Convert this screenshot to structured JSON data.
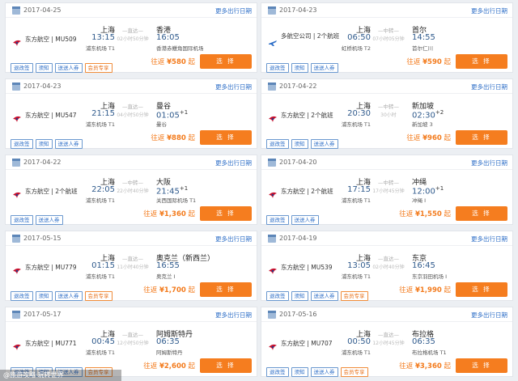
{
  "brand_colors": {
    "accent": "#f57d1f",
    "link": "#2d6ec7",
    "time": "#2f5a8c"
  },
  "more_label": "更多出行日期",
  "select_label": "选 择",
  "dur_label": "—直达—",
  "overlay": "@旅游攻略·玩转世界",
  "cards": [
    {
      "date": "2017-04-25",
      "airline": "东方航空 | MU509",
      "logo": "china-eastern-logo",
      "from": "上海",
      "dep": "13:15",
      "dep_airport": "浦东机场 T1",
      "via": "—直达—",
      "dur": "02小时50分钟",
      "to": "香港",
      "arr": "16:05",
      "arr_airport": "香港赤鱲角国际机场",
      "plus": "",
      "tags": [
        "退改签",
        "须知",
        "送送人券",
        "会员专享"
      ],
      "price_prefix": "往返",
      "price": "¥580",
      "price_suffix": "起"
    },
    {
      "date": "2017-04-23",
      "airline": "多航空公司 | 2个航班",
      "logo": "multi-airline-logo",
      "from": "上海",
      "dep": "06:50",
      "dep_airport": "虹桥机场 T2",
      "via": "—中转—",
      "dur": "07小时05分钟",
      "to": "首尔",
      "arr": "14:55",
      "arr_airport": "首尔仁川",
      "plus": "",
      "tags": [
        "退改签",
        "须知",
        "送送人券"
      ],
      "price_prefix": "往返",
      "price": "¥590",
      "price_suffix": "起"
    },
    {
      "date": "2017-04-23",
      "airline": "东方航空 | MU547",
      "logo": "china-eastern-logo",
      "from": "上海",
      "dep": "21:15",
      "dep_airport": "浦东机场 T1",
      "via": "—直达—",
      "dur": "04小时50分钟",
      "to": "曼谷",
      "arr": "01:05",
      "arr_airport": "曼谷",
      "plus": "+1",
      "tags": [
        "退改签",
        "须知",
        "送送人券"
      ],
      "price_prefix": "往返",
      "price": "¥880",
      "price_suffix": "起"
    },
    {
      "date": "2017-04-22",
      "airline": "东方航空 | 2个航班",
      "logo": "china-eastern-logo",
      "from": "上海",
      "dep": "20:30",
      "dep_airport": "浦东机场 T1",
      "via": "—中转—",
      "dur": "30小时",
      "to": "新加坡",
      "arr": "02:30",
      "arr_airport": "新加坡 3",
      "plus": "+2",
      "tags": [
        "退改签",
        "须知",
        "送送人券"
      ],
      "price_prefix": "往返",
      "price": "¥960",
      "price_suffix": "起"
    },
    {
      "date": "2017-04-22",
      "airline": "东方航空 | 2个航班",
      "logo": "china-eastern-logo",
      "from": "上海",
      "dep": "22:05",
      "dep_airport": "浦东机场 T1",
      "via": "—中转—",
      "dur": "22小时40分钟",
      "to": "大阪",
      "arr": "21:45",
      "arr_airport": "关西国际机场 T1",
      "plus": "+1",
      "tags": [
        "退改签",
        "送送人券"
      ],
      "price_prefix": "往返",
      "price": "¥1,360",
      "price_suffix": "起"
    },
    {
      "date": "2017-04-20",
      "airline": "东方航空 | 2个航班",
      "logo": "china-eastern-logo",
      "from": "上海",
      "dep": "17:15",
      "dep_airport": "浦东机场 T1",
      "via": "—中转—",
      "dur": "17小时45分钟",
      "to": "冲绳",
      "arr": "12:00",
      "arr_airport": "冲绳 I",
      "plus": "+1",
      "tags": [
        "退改签",
        "送送人券"
      ],
      "price_prefix": "往返",
      "price": "¥1,550",
      "price_suffix": "起"
    },
    {
      "date": "2017-05-15",
      "airline": "东方航空 | MU779",
      "logo": "china-eastern-logo",
      "from": "上海",
      "dep": "01:15",
      "dep_airport": "浦东机场 T1",
      "via": "—直达—",
      "dur": "11小时40分钟",
      "to": "奥克兰（新西兰）",
      "arr": "16:55",
      "arr_airport": "奥克兰 I",
      "plus": "",
      "tags": [
        "退改签",
        "须知",
        "送送人券",
        "会员专享"
      ],
      "price_prefix": "往返",
      "price": "¥1,700",
      "price_suffix": "起"
    },
    {
      "date": "2017-04-19",
      "airline": "东方航空 | MU539",
      "logo": "china-eastern-logo",
      "from": "上海",
      "dep": "13:05",
      "dep_airport": "浦东机场 T1",
      "via": "—直达—",
      "dur": "02小时40分钟",
      "to": "东京",
      "arr": "16:45",
      "arr_airport": "东京羽田机场 I",
      "plus": "",
      "tags": [
        "退改签",
        "须知",
        "送送人券",
        "会员专享"
      ],
      "price_prefix": "往返",
      "price": "¥1,990",
      "price_suffix": "起"
    },
    {
      "date": "2017-05-17",
      "airline": "东方航空 | MU771",
      "logo": "china-eastern-logo",
      "from": "上海",
      "dep": "00:45",
      "dep_airport": "浦东机场 T1",
      "via": "—直达—",
      "dur": "12小时50分钟",
      "to": "阿姆斯特丹",
      "arr": "06:35",
      "arr_airport": "阿姆斯特丹",
      "plus": "",
      "tags": [
        "退改签",
        "须知",
        "送送人券",
        "会员专享"
      ],
      "price_prefix": "往返",
      "price": "¥2,600",
      "price_suffix": "起"
    },
    {
      "date": "2017-05-16",
      "airline": "东方航空 | MU707",
      "logo": "china-eastern-logo",
      "from": "上海",
      "dep": "00:50",
      "dep_airport": "浦东机场 T1",
      "via": "—直达—",
      "dur": "12小时45分钟",
      "to": "布拉格",
      "arr": "06:35",
      "arr_airport": "布拉格机场 T1",
      "plus": "",
      "tags": [
        "退改签",
        "须知",
        "送送人券",
        "会员专享"
      ],
      "price_prefix": "往返",
      "price": "¥3,360",
      "price_suffix": "起"
    }
  ]
}
